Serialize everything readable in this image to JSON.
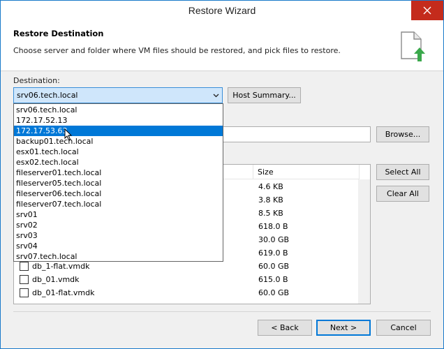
{
  "window": {
    "title": "Restore Wizard"
  },
  "header": {
    "title": "Restore Destination",
    "description": "Choose server and folder where VM files should be restored, and pick files to restore."
  },
  "destination": {
    "label": "Destination:",
    "selected": "srv06.tech.local",
    "host_summary_label": "Host Summary...",
    "options": [
      "srv06.tech.local",
      "172.17.52.13",
      "172.17.53.63",
      "backup01.tech.local",
      "esx01.tech.local",
      "esx02.tech.local",
      "fileserver01.tech.local",
      "fileserver05.tech.local",
      "fileserver06.tech.local",
      "fileserver07.tech.local",
      "srv01",
      "srv02",
      "srv03",
      "srv04",
      "srv07.tech.local"
    ],
    "highlighted": "172.17.53.63"
  },
  "path": {
    "browse_label": "Browse..."
  },
  "files": {
    "columns": {
      "size": "Size"
    },
    "select_all_label": "Select All",
    "clear_all_label": "Clear All",
    "rows": [
      {
        "name": "",
        "size": "4.6 KB"
      },
      {
        "name": "",
        "size": "3.8 KB"
      },
      {
        "name": "",
        "size": "8.5 KB"
      },
      {
        "name": "",
        "size": "618.0 B"
      },
      {
        "name": "",
        "size": "30.0 GB"
      },
      {
        "name": "",
        "size": "619.0 B"
      },
      {
        "name": "db_1-flat.vmdk",
        "size": "60.0 GB"
      },
      {
        "name": "db_01.vmdk",
        "size": "615.0 B"
      },
      {
        "name": "db_01-flat.vmdk",
        "size": "60.0 GB"
      }
    ]
  },
  "footer": {
    "back_label": "< Back",
    "next_label": "Next >",
    "cancel_label": "Cancel"
  }
}
